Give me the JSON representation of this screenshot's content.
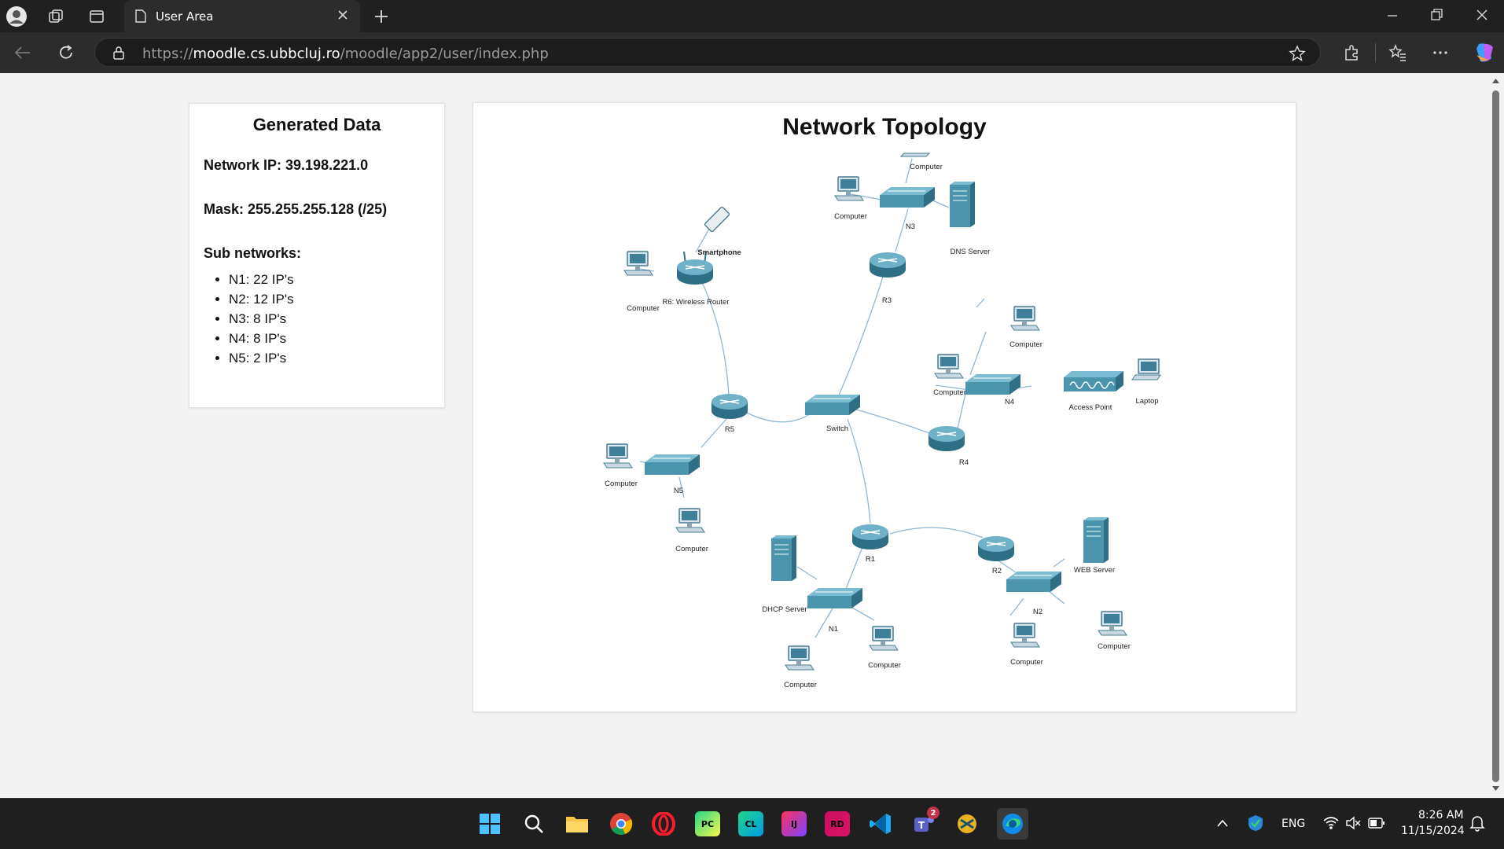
{
  "browser": {
    "tab_title": "User Area",
    "url_prefix": "https://",
    "url_host": "moodle.cs.ubbcluj.ro",
    "url_path": "/moodle/app2/user/index.php"
  },
  "generated": {
    "title": "Generated Data",
    "network_ip": "Network IP: 39.198.221.0",
    "mask": "Mask: 255.255.255.128 (/25)",
    "subnets_label": "Sub networks:",
    "subnets": [
      "N1: 22 IP's",
      "N2: 12 IP's",
      "N3: 8 IP's",
      "N4: 8 IP's",
      "N5: 2 IP's"
    ]
  },
  "topology": {
    "title": "Network Topology",
    "labels": {
      "n3_top_computer": "Computer",
      "n3_left_computer": "Computer",
      "n3": "N3",
      "dns": "DNS Server",
      "smartphone": "Smartphone",
      "r6": "R6: Wireless Router",
      "r6_computer": "Computer",
      "r3": "R3",
      "n4_top_computer": "Computer",
      "n4_left_computer": "Computer",
      "n4": "N4",
      "ap": "Access Point",
      "laptop": "Laptop",
      "r5": "R5",
      "switch": "Switch",
      "r4": "R4",
      "n5_left_computer": "Computer",
      "n5": "N5",
      "n5_bottom_computer": "Computer",
      "r1": "R1",
      "r2": "R2",
      "web": "WEB Server",
      "dhcp": "DHCP Server",
      "n1": "N1",
      "n1_right_computer": "Computer",
      "n1_bottom_computer": "Computer",
      "n2": "N2",
      "n2_right_computer": "Computer",
      "n2_bottom_computer": "Computer"
    }
  },
  "tray": {
    "language": "ENG",
    "time": "8:26 AM",
    "date": "11/15/2024",
    "teams_badge": "2"
  },
  "taskbar": {
    "pycharm": "PC",
    "clion": "CL",
    "intellij": "IJ",
    "rider": "RD"
  },
  "colors": {
    "device": "#4a94ad",
    "device_dark": "#2f6f86",
    "link": "#8fb7d6"
  }
}
